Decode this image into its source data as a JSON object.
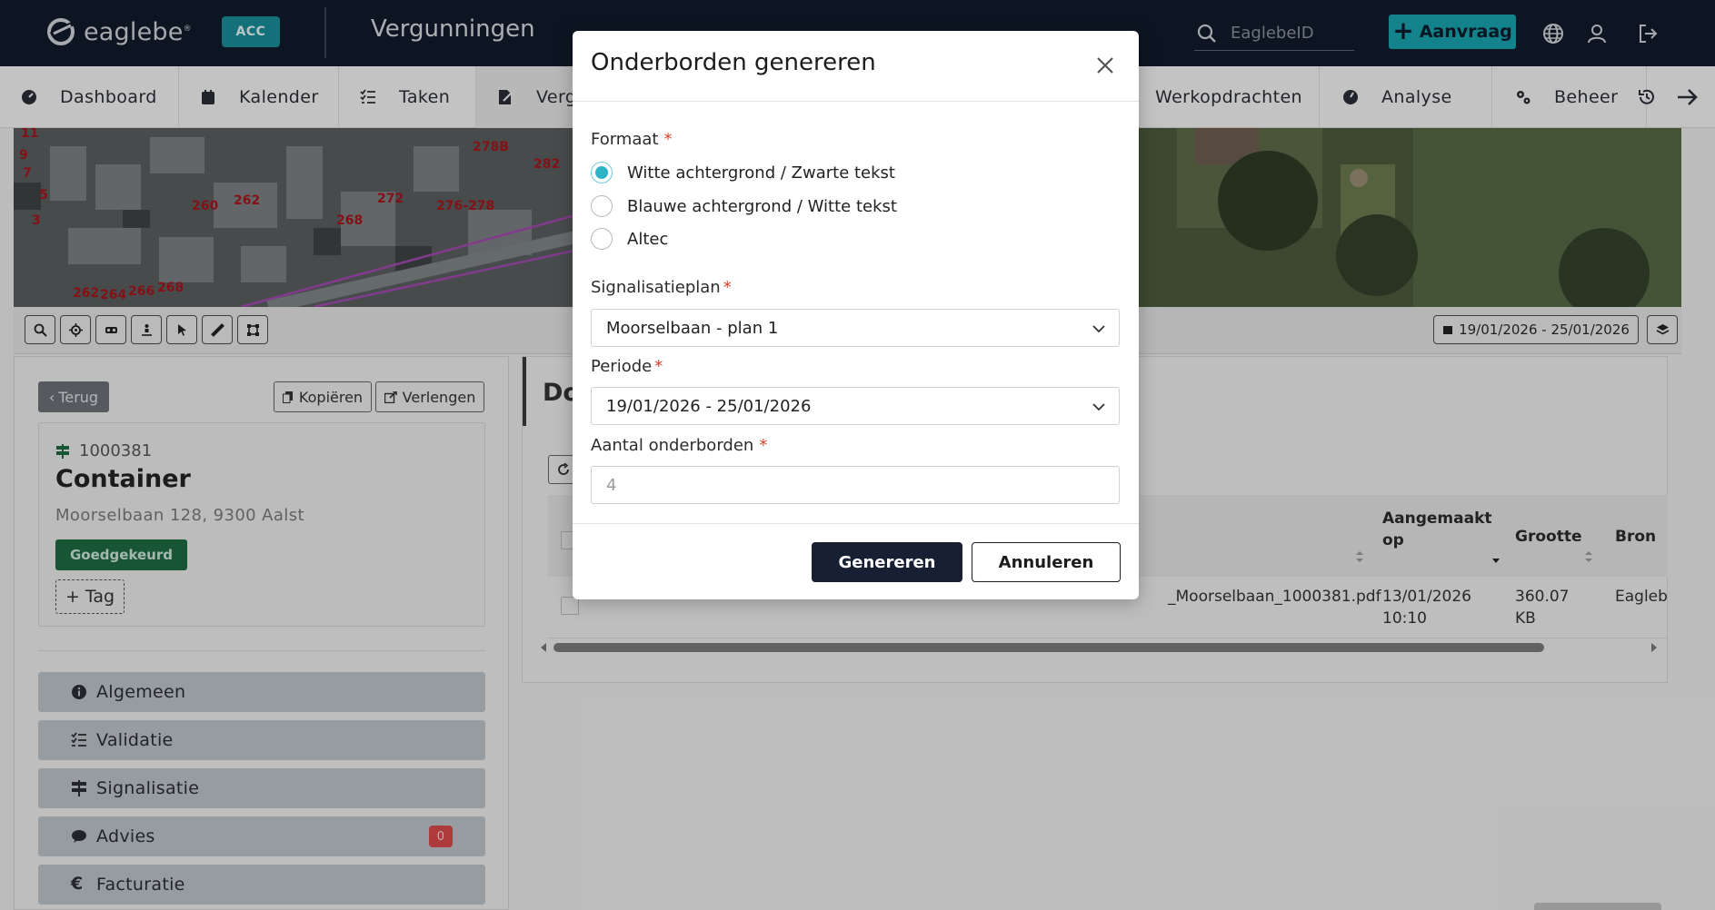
{
  "topbar": {
    "logo_text": "eaglebe",
    "logo_reg": "®",
    "env_badge": "ACC",
    "app_title": "Vergunningen",
    "search_placeholder": "EaglebeID",
    "new_request_label": "Aanvraag",
    "icons": [
      "globe-icon",
      "user-icon",
      "logout-icon"
    ]
  },
  "nav": {
    "items": [
      {
        "label": "Dashboard",
        "icon": "dashboard-icon"
      },
      {
        "label": "Kalender",
        "icon": "calendar-icon"
      },
      {
        "label": "Taken",
        "icon": "tasks-icon"
      },
      {
        "label": "Verg",
        "icon": "permit-icon"
      },
      {
        "label": "Werkopdrachten",
        "icon": "work-orders-icon"
      },
      {
        "label": "Analyse",
        "icon": "analysis-icon"
      },
      {
        "label": "Beheer",
        "icon": "settings-icon"
      }
    ]
  },
  "map": {
    "labels": [
      "11",
      "9",
      "7",
      "5",
      "3",
      "260",
      "262",
      "272",
      "278B",
      "282",
      "276-278",
      "268",
      "262",
      "264",
      "266",
      "268"
    ],
    "date_range": "19/01/2026 - 25/01/2026"
  },
  "left": {
    "back_label": "Terug",
    "copy_label": "Kopiëren",
    "extend_label": "Verlengen",
    "record_id": "1000381",
    "title": "Container",
    "address": "Moorselbaan 128, 9300 Aalst",
    "status": "Goedgekeurd",
    "tag_label": "+ Tag",
    "sections": [
      {
        "label": "Algemeen",
        "icon": "info-icon"
      },
      {
        "label": "Validatie",
        "icon": "checklist-icon"
      },
      {
        "label": "Signalisatie",
        "icon": "signpost-icon"
      },
      {
        "label": "Advies",
        "icon": "comment-icon",
        "count": "0"
      },
      {
        "label": "Facturatie",
        "icon": "euro-icon"
      }
    ]
  },
  "right": {
    "heading": "Do",
    "columns": {
      "created": "Aangemaakt op",
      "size": "Grootte",
      "source": "Bron"
    },
    "row": {
      "file": "_Moorselbaan_1000381.pdf",
      "created": "13/01/2026 10:10",
      "size": "360.07 KB",
      "source": "Eaglebe"
    }
  },
  "modal": {
    "title": "Onderborden genereren",
    "format_label": "Formaat",
    "format_options": [
      "Witte achtergrond / Zwarte tekst",
      "Blauwe achtergrond / Witte tekst",
      "Altec"
    ],
    "format_selected": 0,
    "plan_label": "Signalisatieplan",
    "plan_value": "Moorselbaan - plan 1",
    "period_label": "Periode",
    "period_value": "19/01/2026 - 25/01/2026",
    "count_label": "Aantal onderborden",
    "count_placeholder": "4",
    "required_mark": "*",
    "generate_label": "Genereren",
    "cancel_label": "Annuleren"
  },
  "colors": {
    "topbar": "#111b2b",
    "accent": "#18a3ad",
    "primary_button": "#172033",
    "approved": "#1d6b43",
    "required": "#d9412b"
  }
}
